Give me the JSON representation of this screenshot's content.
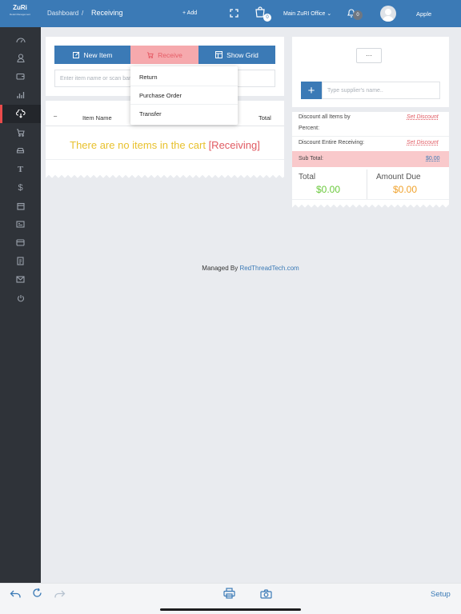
{
  "app": {
    "logo_text": "ZuRi",
    "logo_sub": "Retail Management"
  },
  "header": {
    "breadcrumb_root": "Dashboard",
    "breadcrumb_sep": "/",
    "breadcrumb_current": "Receiving",
    "add_label": "+ Add",
    "cart_badge": "0",
    "location": "Main ZuRI Office",
    "notifications_badge": "0",
    "user_name": "Apple"
  },
  "sidebar": {
    "items": [
      {
        "icon": "dashboard-icon"
      },
      {
        "icon": "user-icon"
      },
      {
        "icon": "wallet-icon"
      },
      {
        "icon": "reports-icon"
      },
      {
        "icon": "receiving-icon",
        "active": true
      },
      {
        "icon": "cart-icon"
      },
      {
        "icon": "car-icon"
      },
      {
        "icon": "text-icon"
      },
      {
        "icon": "dollar-icon"
      },
      {
        "icon": "calendar-icon"
      },
      {
        "icon": "id-card-icon"
      },
      {
        "icon": "credit-card-icon"
      },
      {
        "icon": "document-icon"
      },
      {
        "icon": "envelope-icon"
      },
      {
        "icon": "power-icon"
      }
    ]
  },
  "toolbar": {
    "new_item_label": "New Item",
    "receive_label": "Receive",
    "show_grid_label": "Show Grid",
    "search_placeholder": "Enter item name or scan barcode"
  },
  "receive_menu": {
    "items": [
      "Return",
      "Purchase Order",
      "Transfer"
    ]
  },
  "cart_table": {
    "columns": [
      "–",
      "Item Name",
      "Total"
    ],
    "empty_text": "There are no items in the cart",
    "empty_mode": "[Receiving]"
  },
  "right_panel": {
    "more_label": "···",
    "supplier_placeholder": "Type supplier's name..",
    "discount_all_label": "Discount all Items by",
    "percent_label": "Percent:",
    "discount_entire_label": "Discount Entire Receiving:",
    "set_discount_label": "Set Discount",
    "subtotal_label": "Sub Total:",
    "subtotal_value": "$0.00",
    "total_label": "Total",
    "total_value": "$0.00",
    "amount_due_label": "Amount Due",
    "amount_due_value": "$0.00"
  },
  "footer": {
    "managed_by": "Managed By",
    "company": "RedThreadTech.com",
    "setup_label": "Setup"
  },
  "colors": {
    "primary": "#3b7ab6",
    "accent_red": "#e05a62",
    "empty_yellow": "#e8c12d",
    "total_green": "#6ac93c",
    "amount_due_orange": "#f0a22c"
  }
}
